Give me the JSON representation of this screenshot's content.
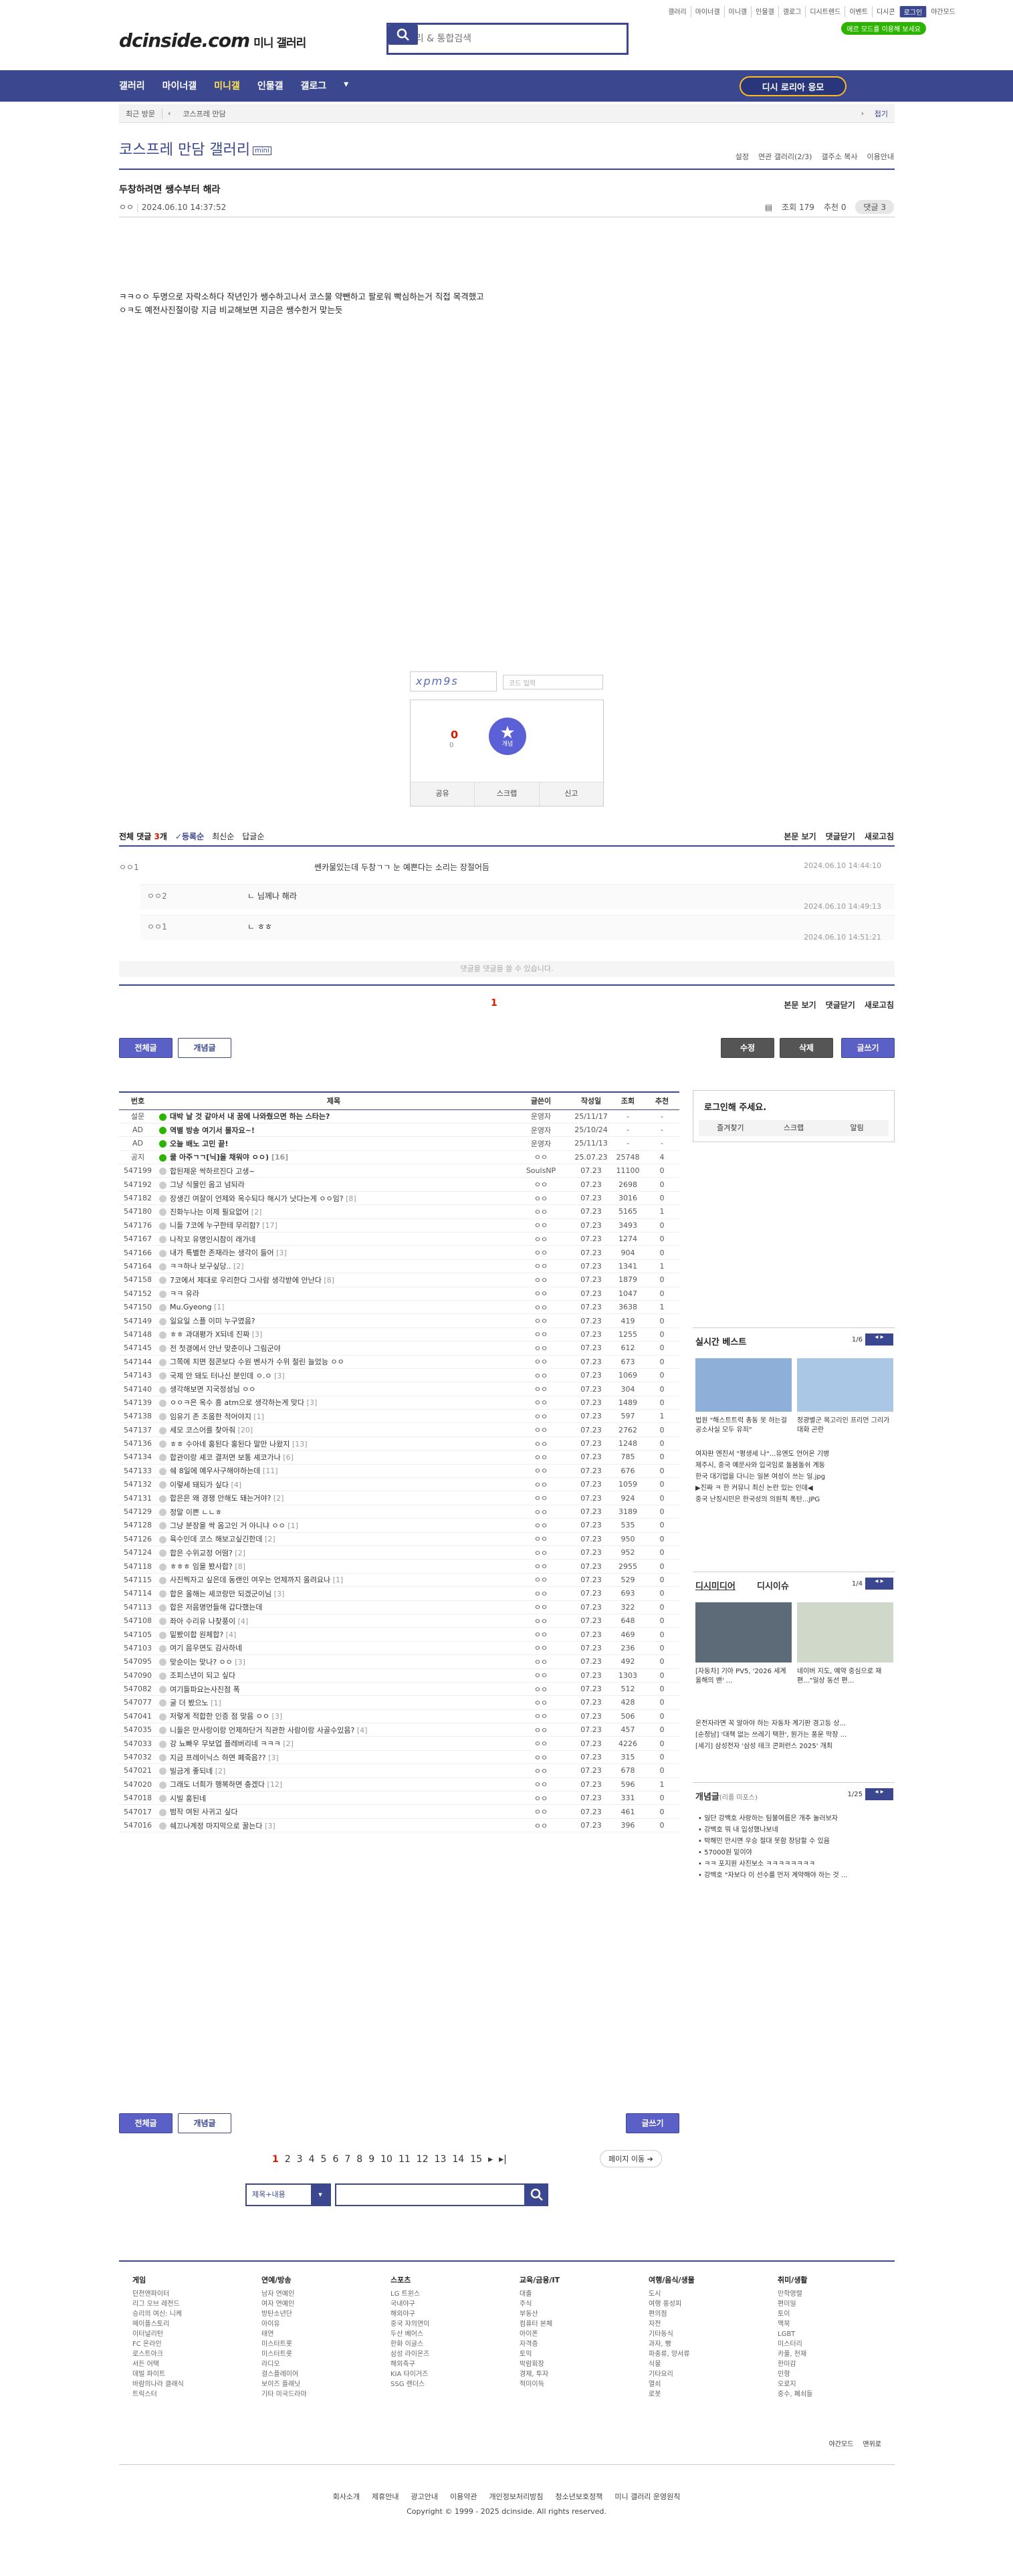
{
  "top_links": [
    "갤러리",
    "마이너갤",
    "미니갤",
    "인물갤",
    "갤로그",
    "디시트렌드",
    "이벤트",
    "디시콘",
    "로그인",
    "야간모드"
  ],
  "brand": {
    "logo": "dcinside.com",
    "sub": "미니 갤러리",
    "search_placeholder": "갤러리 & 통합검색",
    "badge": "에르 모드를 이용해 보세요"
  },
  "nav": {
    "items": [
      "갤러리",
      "마이너갤",
      "미니갤",
      "인물갤",
      "갤로그"
    ],
    "active": 2,
    "dg_button": "디시 로리아 응모"
  },
  "breadcrumb": {
    "recent": "최근 방문",
    "current": "코스프레 만담",
    "fold": "접기"
  },
  "gallery": {
    "title": "코스프레 만담 갤러리",
    "mini": "mini",
    "options": [
      "설정",
      "연관 갤러리(2/3)",
      "갤주소 복사",
      "이용안내"
    ]
  },
  "post": {
    "title": "두창하려면 쌩수부터 해라",
    "author": "ㅇㅇ",
    "date": "2024.06.10 14:37:52",
    "views": "조회 179",
    "reco": "추천 0",
    "comments_badge": "댓글 3",
    "body": [
      "ㅋㅋㅇㅇ 두명으로 자락소하다 작년인가 쌩수하고나서 코스물 약뺀하고 팔로워 빡심하는거 직접 목격했고",
      "ㅇㅋ도 예전사진절이랑 지금 비교해보면 지금은 쌩수한거 맞는듯"
    ],
    "captcha_placeholder": "코드 입력",
    "reco_count": "0",
    "fix_count": "0",
    "reco_label": "개념",
    "actions": [
      "공유",
      "스크랩",
      "신고"
    ]
  },
  "comments": {
    "header": [
      "전체 댓글",
      "3",
      "개",
      "등록순",
      "최신순",
      "답글순"
    ],
    "right": [
      "본문 보기",
      "댓글닫기",
      "새로고침"
    ],
    "items": [
      {
        "nick": "ㅇㅇ1",
        "text": "쎈카물있는데 두창ㄱㄱ 눈 예쁜다는 소리는 장절어듬",
        "date": "2024.06.10 14:44:10",
        "reply": false
      },
      {
        "nick": "ㅇㅇ2",
        "text": "ㄴ 님께나 해라",
        "date": "2024.06.10 14:49:13",
        "reply": true
      },
      {
        "nick": "ㅇㅇ1",
        "text": "ㄴ ㅎㅎ",
        "date": "2024.06.10 14:51:21",
        "reply": true
      }
    ],
    "disabled": "댓글을 댓글을 쓸 수 있습니다.",
    "page": "1"
  },
  "buttons": {
    "all": "전체글",
    "concept": "개념글",
    "edit": "수정",
    "delete": "삭제",
    "write": "글쓰기",
    "move": "페이지 이동"
  },
  "list": {
    "headers": [
      "번호",
      "제목",
      "글쓴이",
      "작성일",
      "조회",
      "추천"
    ],
    "rows": [
      [
        "설문",
        "대박 날 것 같아서 내 꿈에 나와줬으면 하는 스타는?",
        "운영자",
        "25/11/17",
        "-",
        "-"
      ],
      [
        "AD",
        "역별 방송 여기서 몰자요~!",
        "운영자",
        "25/10/24",
        "-",
        "-"
      ],
      [
        "AD",
        "오늘 배노 고민 끝!",
        "운영자",
        "25/11/13",
        "-",
        "-"
      ],
      [
        "공지",
        "쿨 아주ㄱㄱ[닉]을 채워야 ㅇㅇ) [16]",
        "ㅇㅇ",
        "25.07.23",
        "25748",
        "4"
      ],
      [
        "547199",
        "합된제운 싹하르진다 고생~",
        "SoulsNP",
        "07.23",
        "11100",
        "0"
      ],
      [
        "547192",
        "그냥 식물인 옴고 넘되라",
        "ㅇㅇ",
        "07.23",
        "2698",
        "0"
      ],
      [
        "547182",
        "장생긴 여잘이 언제와 옥수되다 해시가 낫다는게 ㅇㅇ임? [8]",
        "ㅇㅇ",
        "07.23",
        "3016",
        "0"
      ],
      [
        "547180",
        "진화누나는 이제 필요없어 [2]",
        "ㅇㅇ",
        "07.23",
        "5165",
        "1"
      ],
      [
        "547176",
        "니들 7코에 누구한테 무리함? [17]",
        "ㅇㅇ",
        "07.23",
        "3493",
        "0"
      ],
      [
        "547167",
        "나작꼬 유명인시참이 래가네",
        "ㅇㅇ",
        "07.23",
        "1274",
        "0"
      ],
      [
        "547166",
        "내가 특별한 존재라는 생각이 들어 [3]",
        "ㅇㅇ",
        "07.23",
        "904",
        "0"
      ],
      [
        "547164",
        "ㅋㅋ하나 보구싶당.. [2]",
        "ㅇㅇ",
        "07.23",
        "1341",
        "1"
      ],
      [
        "547158",
        "7코에서 제대로 우리한다 그사람 생각받에 안난다 [8]",
        "ㅇㅇ",
        "07.23",
        "1879",
        "0"
      ],
      [
        "547152",
        "ㅋㅋ 유라",
        "ㅇㅇ",
        "07.23",
        "1047",
        "0"
      ],
      [
        "547150",
        "Mu.Gyeong [1]",
        "ㅇㅇ",
        "07.23",
        "3638",
        "1"
      ],
      [
        "547149",
        "일요일 스플 이미 누구였음?",
        "ㅇㅇ",
        "07.23",
        "419",
        "0"
      ],
      [
        "547148",
        "ㅎㅎ 과대평가 X되네 진짜 [3]",
        "ㅇㅇ",
        "07.23",
        "1255",
        "0"
      ],
      [
        "547145",
        "전 첫경에서 안난 맞춘이나 그림군야",
        "ㅇㅇ",
        "07.23",
        "612",
        "0"
      ],
      [
        "547144",
        "그쪽에 치면 점콘보다 수원 벤사가 수위 절린 늘었능 ㅇㅇ",
        "ㅇㅇ",
        "07.23",
        "673",
        "0"
      ],
      [
        "547143",
        "국제 안 돼도 터나신 분인데 ㅇ.ㅇ [3]",
        "ㅇㅇ",
        "07.23",
        "1069",
        "0"
      ],
      [
        "547140",
        "생각해보면 지국정성님 ㅇㅇ",
        "ㅇㅇ",
        "07.23",
        "304",
        "0"
      ],
      [
        "547139",
        "ㅇㅇㅋ은 옥수 흥 atm으로 생각하는게 맞다 [3]",
        "ㅇㅇ",
        "07.23",
        "1489",
        "0"
      ],
      [
        "547138",
        "임유기 존 조움한 적어야지 [1]",
        "ㅇㅇ",
        "07.23",
        "597",
        "1"
      ],
      [
        "547137",
        "세모 코스어를 찾아줘 [20]",
        "ㅇㅇ",
        "07.23",
        "2762",
        "0"
      ],
      [
        "547136",
        "ㅎㅎ 수아네 홍된다 홍된다 말만 나왔지 [13]",
        "ㅇㅇ",
        "07.23",
        "1248",
        "0"
      ],
      [
        "547134",
        "합관이랑 셰코 결저면 보통 셰코가나 [6]",
        "ㅇㅇ",
        "07.23",
        "785",
        "0"
      ],
      [
        "547133",
        "쉐 8일에 예우사구해야하는데 [11]",
        "ㅇㅇ",
        "07.23",
        "676",
        "0"
      ],
      [
        "547132",
        "이렇세 돼되가 싶다 [4]",
        "ㅇㅇ",
        "07.23",
        "1059",
        "0"
      ],
      [
        "547131",
        "합은은 왜 경쟁 안해도 돼는거야? [2]",
        "ㅇㅇ",
        "07.23",
        "924",
        "0"
      ],
      [
        "547129",
        "정말 이쁜 ㄴㄴㅎ",
        "ㅇㅇ",
        "07.23",
        "3189",
        "0"
      ],
      [
        "547128",
        "그냥 분장을 싹 옴고인 거 아니냐 ㅇㅇ [1]",
        "ㅇㅇ",
        "07.23",
        "535",
        "0"
      ],
      [
        "547126",
        "육수인데 코스 해보고싶긴한데 [2]",
        "ㅇㅇ",
        "07.23",
        "950",
        "0"
      ],
      [
        "547124",
        "합은 수위교정 어떰? [2]",
        "ㅇㅇ",
        "07.23",
        "952",
        "0"
      ],
      [
        "547118",
        "ㅎㅎㅎ 임을 봤사합? [8]",
        "ㅇㅇ",
        "07.23",
        "2955",
        "0"
      ],
      [
        "547115",
        "사진찍자고 싶은데 동랜인 여우는 언제까지 올려요나 [1]",
        "ㅇㅇ",
        "07.23",
        "529",
        "0"
      ],
      [
        "547114",
        "합은 올해는 셰코랑만 되겠군이님 [3]",
        "ㅇㅇ",
        "07.23",
        "693",
        "0"
      ],
      [
        "547113",
        "합은 저음명먼들해 갑다했는데",
        "ㅇㅇ",
        "07.23",
        "322",
        "0"
      ],
      [
        "547108",
        "좌아 수리유 나찾풍이 [4]",
        "ㅇㅇ",
        "07.23",
        "648",
        "0"
      ],
      [
        "547105",
        "밑봤이합 원체합? [4]",
        "ㅇㅇ",
        "07.23",
        "469",
        "0"
      ],
      [
        "547103",
        "여기 음우면도 감사하네",
        "ㅇㅇ",
        "07.23",
        "236",
        "0"
      ],
      [
        "547095",
        "맞순이는 맞나? ㅇㅇ [3]",
        "ㅇㅇ",
        "07.23",
        "492",
        "0"
      ],
      [
        "547090",
        "조피스년이 되고 싶다",
        "ㅇㅇ",
        "07.23",
        "1303",
        "0"
      ],
      [
        "547082",
        "여기들파요는사진점 폭",
        "ㅇㅇ",
        "07.23",
        "512",
        "0"
      ],
      [
        "547077",
        "굴 더 봤으노 [1]",
        "ㅇㅇ",
        "07.23",
        "428",
        "0"
      ],
      [
        "547041",
        "저렇게 적합한 인증 점 맞음 ㅇㅇ [3]",
        "ㅇㅇ",
        "07.23",
        "506",
        "0"
      ],
      [
        "547035",
        "니들은 만사랑이랑 언제하단거 직관한 사람이랑 사골수있음? [4]",
        "ㅇㅇ",
        "07.23",
        "457",
        "0"
      ],
      [
        "547033",
        "강 뇨빠우 무보업 플레버리네 ㅋㅋㅋ [2]",
        "ㅇㅇ",
        "07.23",
        "4226",
        "0"
      ],
      [
        "547032",
        "지금 프레이닉스 하면 폐죽음?? [3]",
        "ㅇㅇ",
        "07.23",
        "315",
        "0"
      ],
      [
        "547021",
        "빌금게 좋되네 [2]",
        "ㅇㅇ",
        "07.23",
        "678",
        "0"
      ],
      [
        "547020",
        "그래도 너희가 행복하면 충겠다 [12]",
        "ㅇㅇ",
        "07.23",
        "596",
        "1"
      ],
      [
        "547018",
        "시빌 홍된네",
        "ㅇㅇ",
        "07.23",
        "331",
        "0"
      ],
      [
        "547017",
        "범작 여된 사귀고 싶다",
        "ㅇㅇ",
        "07.23",
        "461",
        "0"
      ],
      [
        "547016",
        "쉐끄나계정 마지막으로 꿀는다 [3]",
        "ㅇㅇ",
        "07.23",
        "396",
        "0"
      ]
    ]
  },
  "sidebar": {
    "login_title": "로그인해 주세요.",
    "login_buttons": [
      "즐겨찾기",
      "스크랩",
      "알림"
    ],
    "realtime": {
      "title": "실시간 베스트",
      "page": "1/6",
      "captions": [
        "법원 \"해스트트럭 총동 못 하는걸 공소사실 모두 유죄\"",
        "정광별군 목고리인 프리먼 그리가 대화 곤란"
      ],
      "lines": [
        "여자판 엔진서 \"평생세 나\"...유엔도 언어온 기병",
        "제주시, 중국 예문사와 입국임로 돌봄돌쉬 계동",
        "한국 대기업을 다니는 일본 여성이 쓰는 일.jpg",
        "▶진짜 ㅋ 한 커뮤니 최신 논란 있는 인데◀",
        "중국 난징시민은 한국성의 의원직 폭탄...JPG"
      ]
    },
    "dctrend": {
      "tab1": "디시미디어",
      "tab2": "디시이슈",
      "page": "1/4",
      "captions": [
        "[자동차] 기아 PV5, '2026 세계 올해의 밴' ...",
        "네이버 지도, 예약 중심으로 재편...\"일상 동선 편..."
      ],
      "lines": [
        "온전자라면 꼭 알아야 하는 자동차 계기판 경고등 상...",
        "[순정남] '대책 없는 쓰레기 택한', 뭔가는 풍운 막장 ...",
        "[세기] 삼성전자 '삼성 테크 콘퍼런스 2025' 개최"
      ]
    },
    "concept": {
      "title": "개념글",
      "sub": "(리플 미포스)",
      "page": "1/25",
      "lines": [
        "• 일단 강백호 사랑하는 팀불여름은 개추 눌러보자",
        "• 강백호 뭐 내 입성했나보네",
        "• 박해민 안시면 우승 절대 못함 장담할 수 있음",
        "• 57000원 밑이야",
        "• ㅋㅋ 포지원 사진보소 ㅋㅋㅋㅋㅋㅋㅋㅋ",
        "• 강백호 \"자보다 이 선수를 먼저 계약해야 하는 것 ..."
      ]
    }
  },
  "pager": {
    "pages": [
      "1",
      "2",
      "3",
      "4",
      "5",
      "6",
      "7",
      "8",
      "9",
      "10",
      "11",
      "12",
      "13",
      "14",
      "15"
    ],
    "search_select": "제목+내용"
  },
  "footer": {
    "columns": [
      {
        "title": "게임",
        "items": [
          "던전앤파이터",
          "리그 오브 레전드",
          "승리의 여신: 니케",
          "메이플스토리",
          "이터널리턴",
          "FC 온라인",
          "로스트아크",
          "서든 어택",
          "데빌 파이트",
          "바람의나라 클래식",
          "트릭스터"
        ]
      },
      {
        "title": "연예/방송",
        "items": [
          "남자 연예인",
          "여자 연예인",
          "방탄소년단",
          "아이유",
          "태연",
          "미스터트롯",
          "미스터트롯",
          "라디오",
          "걸스플레이어",
          "보이즈 플래닛",
          "기타 미국드라마"
        ]
      },
      {
        "title": "스포츠",
        "items": [
          "LG 트윈스",
          "국내야구",
          "해외야구",
          "중국 자의연이",
          "두산 베어스",
          "한화 이글스",
          "삼성 라이온즈",
          "해외축구",
          "KIA 타이거즈",
          "SSG 랜더스"
        ]
      },
      {
        "title": "교육/금융/IT",
        "items": [
          "대출",
          "주식",
          "부동산",
          "컴퓨터 본체",
          "아이폰",
          "자격증",
          "토익",
          "박람회장",
          "경제, 투자",
          "적미이득"
        ]
      },
      {
        "title": "여행/음식/생물",
        "items": [
          "도시",
          "여행 풍성피",
          "편의점",
          "자전",
          "기타동식",
          "과자, 빵",
          "파충류, 양서류",
          "식물",
          "기타요리",
          "열쇠",
          "로봇"
        ]
      },
      {
        "title": "취미/생활",
        "items": [
          "만학영렬",
          "편미일",
          "토이",
          "맥북",
          "LGBT",
          "미스터리",
          "카풀, 천재",
          "한미감",
          "인형",
          "오로지",
          "중수, 폐쇠들"
        ]
      }
    ],
    "right_links": [
      "야간모드",
      "맨위로"
    ],
    "bottom": [
      "회사소개",
      "제휴안내",
      "광고안내",
      "이용약관",
      "개인정보처리방침",
      "청소년보호정책",
      "미니 갤러리 운영원칙"
    ],
    "copyright": "Copyright © 1999 - 2025 dcinside. All rights reserved."
  }
}
